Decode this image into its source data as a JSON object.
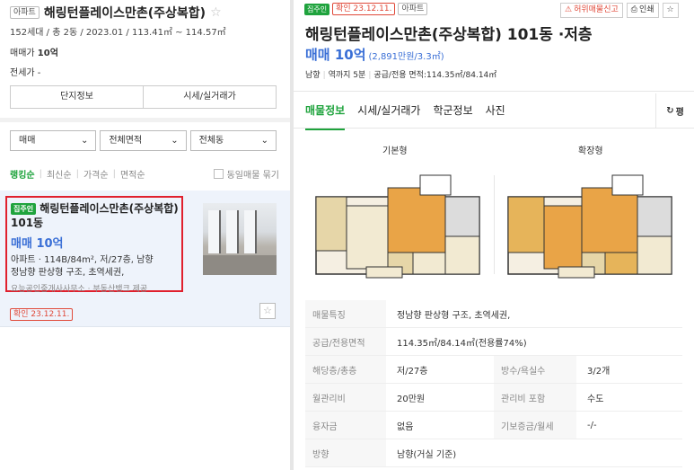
{
  "left": {
    "header": {
      "type_tag": "아파트",
      "title": "해링턴플레이스만촌(주상복합)",
      "sub": "152세대 / 총 2동 / 2023.01 / 113.41㎡ ~ 114.57㎡",
      "sale_label": "매매가",
      "sale_value": "10억",
      "jeonse": "전세가 -"
    },
    "buttons": [
      "단지정보",
      "시세/실거래가"
    ],
    "selects": [
      "매매",
      "전체면적",
      "전체동"
    ],
    "sort": [
      "랭킹순",
      "최신순",
      "가격순",
      "면적순"
    ],
    "dup_label": "동일매물 묶기",
    "listing": {
      "tag": "집주인",
      "title": "해링턴플레이스만촌(주상복합) 101동",
      "price": "매매 10억",
      "spec": "아파트 · 114B/84m², 저/27층, 남향",
      "desc": "정남향 판상형 구조, 초역세권,",
      "agent": "요능공인중개사사무소 · 부동산뱅크 제공",
      "confirm": "확인 23.12.11."
    }
  },
  "right": {
    "tags": [
      "집주인",
      "확인 23.12.11.",
      "아파트"
    ],
    "actions": [
      "허위매물신고",
      "인쇄"
    ],
    "title": "해링턴플레이스만촌(주상복합) 101동 ·저층",
    "price": "매매 10억",
    "price_sub": "(2,891만원/3.3㎡)",
    "meta": [
      "남향",
      "역까지 5분",
      "공급/전용 면적:114.35㎡/84.14㎡"
    ],
    "tabs": [
      "매물정보",
      "시세/실거래가",
      "학군정보",
      "사진"
    ],
    "pyeong": "평",
    "floorplans": [
      "기본형",
      "확장형"
    ],
    "info": [
      {
        "k": "매물특징",
        "v": "정남향 판상형 구조, 초역세권,"
      },
      {
        "k": "공급/전용면적",
        "v": "114.35㎡/84.14㎡(전용률74%)"
      },
      {
        "k": "해당층/총층",
        "v": "저/27층",
        "k2": "방수/욕실수",
        "v2": "3/2개"
      },
      {
        "k": "월관리비",
        "v": "20만원",
        "k2": "관리비 포함",
        "v2": "수도"
      },
      {
        "k": "융자금",
        "v": "없음",
        "k2": "기보증금/월세",
        "v2": "-/-"
      },
      {
        "k": "방향",
        "v": "남향(거실 기준)"
      }
    ]
  }
}
